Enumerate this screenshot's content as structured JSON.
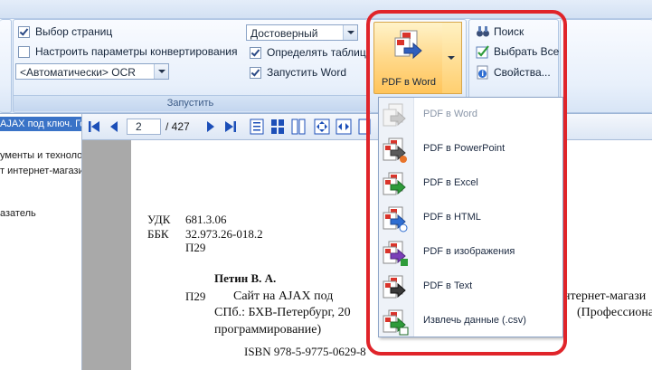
{
  "ribbon": {
    "page_select_label": "Выбор страниц",
    "conversion_settings_label": "Настроить параметры конвертирования",
    "ocr_combo_value": "<Автоматически> OCR",
    "quality_combo_value": "Достоверный",
    "detect_tables_label": "Определять таблицы",
    "launch_word_label": "Запустить Word",
    "group_label": "Запустить",
    "main_button_label": "PDF в Word",
    "search_label": "Поиск",
    "select_all_label": "Выбрать Все",
    "properties_label": "Свойства..."
  },
  "left_panel": {
    "selected_tab": "AJAX под ключ. Го",
    "items": [
      "ументы и технолог",
      "т интернет-магази",
      "азатель"
    ]
  },
  "viewer": {
    "current_page": "2",
    "total_pages": "/ 427"
  },
  "document": {
    "udk_label": "УДК",
    "udk_value": "681.3.06",
    "bbk_label": "ББК",
    "bbk_value": "32.973.26-018.2",
    "code": "П29",
    "author": "Петин В. А.",
    "code2": "П29",
    "line1_left": "Сайт на AJAX под",
    "line1_right": "нтернет-магази",
    "line2_left": "СПб.: БХВ-Петербург, 20",
    "line2_right": "(Профессиона",
    "line3": "программирование)",
    "isbn": "ISBN 978-5-9775-0629-8"
  },
  "menu": {
    "items": [
      {
        "label": "PDF в Word",
        "icon": "pdf-to-word-icon",
        "disabled": true
      },
      {
        "label": "PDF в PowerPoint",
        "icon": "pdf-to-powerpoint-icon",
        "disabled": false
      },
      {
        "label": "PDF в Excel",
        "icon": "pdf-to-excel-icon",
        "disabled": false
      },
      {
        "label": "PDF в HTML",
        "icon": "pdf-to-html-icon",
        "disabled": false
      },
      {
        "label": "PDF в изображения",
        "icon": "pdf-to-image-icon",
        "disabled": false
      },
      {
        "label": "PDF в Text",
        "icon": "pdf-to-text-icon",
        "disabled": false
      },
      {
        "label": "Извлечь данные (.csv)",
        "icon": "extract-csv-icon",
        "disabled": false
      }
    ]
  },
  "colors": {
    "highlight": "#e0242a",
    "ribbon_bg": "#dfe9f6",
    "selected_tab": "#3a73c7",
    "button_hover": "#ffd98b"
  }
}
